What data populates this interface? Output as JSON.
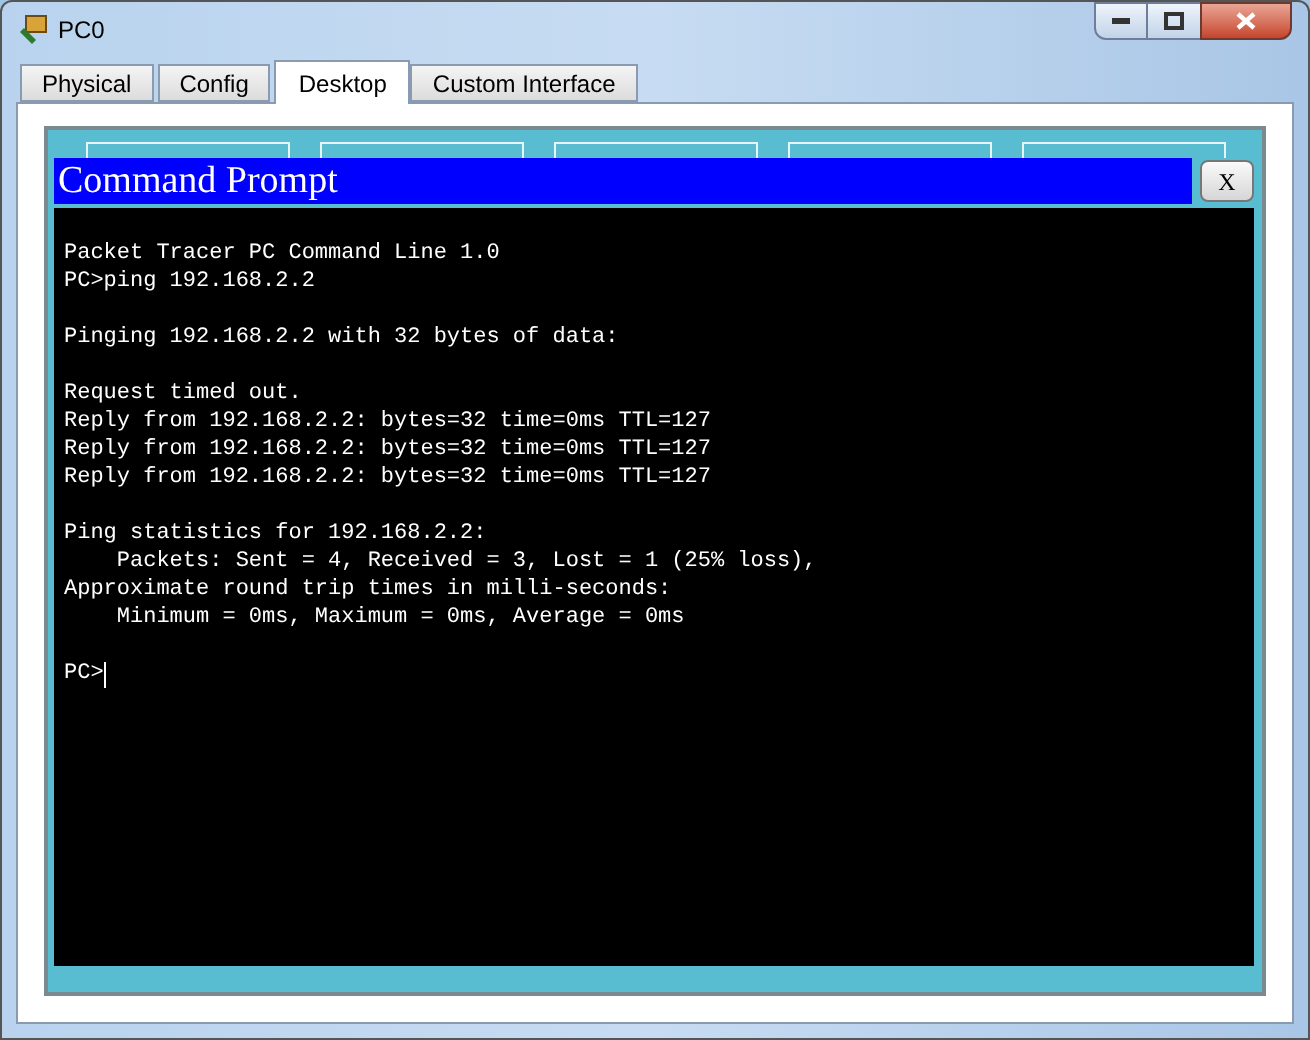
{
  "window": {
    "title": "PC0"
  },
  "tabs": [
    {
      "label": "Physical",
      "selected": false
    },
    {
      "label": "Config",
      "selected": false
    },
    {
      "label": "Desktop",
      "selected": true
    },
    {
      "label": "Custom Interface",
      "selected": false
    }
  ],
  "command_prompt": {
    "title": "Command Prompt",
    "close_label": "X",
    "blocks": [
      [
        "Packet Tracer PC Command Line 1.0",
        "PC>ping 192.168.2.2"
      ],
      [
        "Pinging 192.168.2.2 with 32 bytes of data:"
      ],
      [
        "Request timed out.",
        "Reply from 192.168.2.2: bytes=32 time=0ms TTL=127",
        "Reply from 192.168.2.2: bytes=32 time=0ms TTL=127",
        "Reply from 192.168.2.2: bytes=32 time=0ms TTL=127"
      ],
      [
        "Ping statistics for 192.168.2.2:",
        "    Packets: Sent = 4, Received = 3, Lost = 1 (25% loss),",
        "Approximate round trip times in milli-seconds:",
        "    Minimum = 0ms, Maximum = 0ms, Average = 0ms"
      ]
    ],
    "prompt": "PC>",
    "cursor": true
  }
}
